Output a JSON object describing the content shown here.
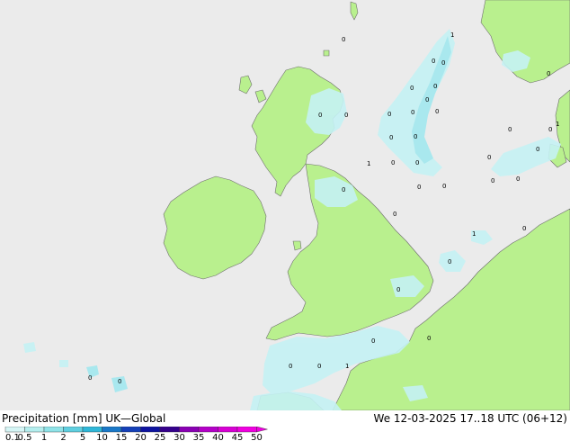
{
  "header": {
    "title": "Precipitation [mm]",
    "model": "UK—Global",
    "valid_time": "We 12-03-2025 17..18 UTC (06+12)"
  },
  "legend": {
    "labels": [
      "0.1",
      "0.5",
      "1",
      "2",
      "5",
      "10",
      "15",
      "20",
      "25",
      "30",
      "35",
      "40",
      "45",
      "50"
    ],
    "colors": [
      "#d5f5f5",
      "#b4eeee",
      "#8fe3e8",
      "#5fcfe0",
      "#2fb7d8",
      "#1a78c8",
      "#1540b8",
      "#0e14a0",
      "#35008c",
      "#8a00b4",
      "#b400c8",
      "#d800d4",
      "#f000e0"
    ]
  },
  "colors": {
    "sea": "#ebebeb",
    "land": "#b9f08e",
    "coast": "#6e6e6e",
    "rain_light": "#c5f2f4",
    "rain_mid": "#a2e8ef"
  },
  "map_values": [
    {
      "id": "v01",
      "text": "1"
    },
    {
      "id": "v02",
      "text": "0"
    },
    {
      "id": "v03",
      "text": "0"
    },
    {
      "id": "v04",
      "text": "0"
    },
    {
      "id": "v05",
      "text": "0"
    },
    {
      "id": "v06",
      "text": "0"
    },
    {
      "id": "v07",
      "text": "0"
    },
    {
      "id": "v08",
      "text": "0"
    },
    {
      "id": "v09",
      "text": "0"
    },
    {
      "id": "v10",
      "text": "0"
    },
    {
      "id": "v11",
      "text": "0"
    },
    {
      "id": "v12",
      "text": "0"
    },
    {
      "id": "v13",
      "text": "0"
    },
    {
      "id": "v14",
      "text": "0"
    },
    {
      "id": "v15",
      "text": "1"
    },
    {
      "id": "v16",
      "text": "0"
    },
    {
      "id": "v17",
      "text": "0"
    },
    {
      "id": "v18",
      "text": "0"
    },
    {
      "id": "v19",
      "text": "0"
    },
    {
      "id": "v20",
      "text": "0"
    },
    {
      "id": "v21",
      "text": "0"
    },
    {
      "id": "v22",
      "text": "0"
    },
    {
      "id": "v23",
      "text": "0"
    },
    {
      "id": "v24",
      "text": "0"
    },
    {
      "id": "v25",
      "text": "0"
    },
    {
      "id": "v26",
      "text": "0"
    },
    {
      "id": "v27",
      "text": "0"
    },
    {
      "id": "v28",
      "text": "1"
    },
    {
      "id": "v29",
      "text": "0"
    },
    {
      "id": "v30",
      "text": "0"
    },
    {
      "id": "v31",
      "text": "1"
    },
    {
      "id": "v32",
      "text": "0"
    },
    {
      "id": "v33",
      "text": "0"
    },
    {
      "id": "v34",
      "text": "0"
    },
    {
      "id": "v35",
      "text": "0"
    },
    {
      "id": "v36",
      "text": "0"
    },
    {
      "id": "v37",
      "text": "0"
    },
    {
      "id": "v38",
      "text": "1"
    },
    {
      "id": "v39",
      "text": "0"
    },
    {
      "id": "v40",
      "text": "0"
    }
  ]
}
